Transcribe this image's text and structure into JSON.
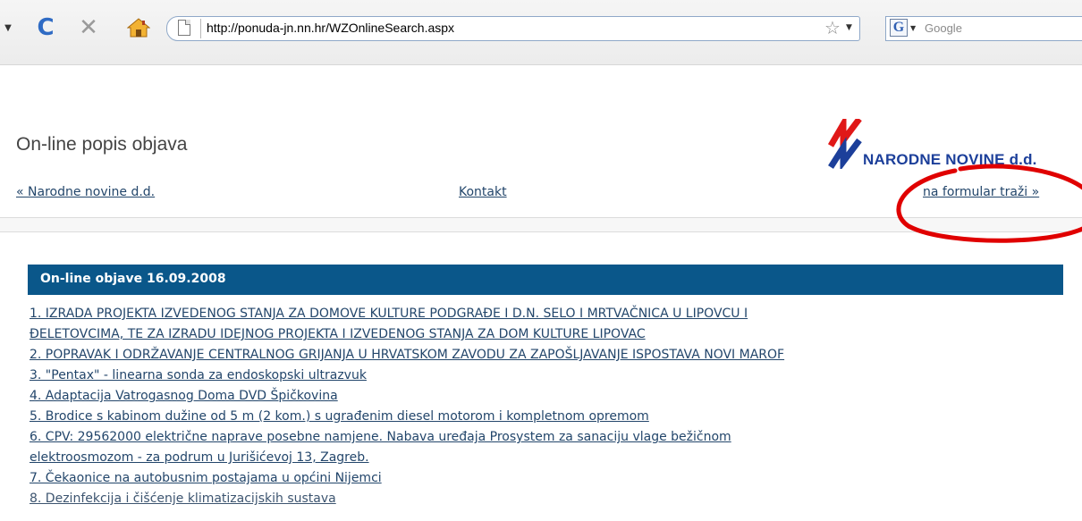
{
  "browser": {
    "url": "http://ponuda-jn.nn.hr/WZOnlineSearch.aspx",
    "search_placeholder": "Google",
    "reload_icon": "reload-icon",
    "stop_icon": "stop-icon",
    "home_icon": "home-icon",
    "search_engine_letter": "G"
  },
  "page": {
    "title": "On-line popis objava",
    "logo_text": "NARODNE NOVINE d.d.",
    "nav": {
      "back_link": "« Narodne novine d.d.",
      "contact_link": "Kontakt",
      "search_form_link": "na formular traži »"
    },
    "section_title": "On-line objave 16.09.2008",
    "items": [
      "1. IZRADA PROJEKTA IZVEDENOG STANJA ZA DOMOVE KULTURE PODGRAĐE I D.N. SELO I MRTVAČNICA U LIPOVCU I",
      "ĐELETOVCIMA, TE ZA IZRADU IDEJNOG PROJEKTA I IZVEDENOG STANJA ZA DOM KULTURE LIPOVAC",
      "2. POPRAVAK I ODRŽAVANJE CENTRALNOG GRIJANJA U HRVATSKOM ZAVODU ZA ZAPOŠLJAVANJE ISPOSTAVA NOVI MAROF",
      "3. \"Pentax\" - linearna sonda za endoskopski ultrazvuk",
      "4. Adaptacija Vatrogasnog Doma DVD Špičkovina",
      "5. Brodice s kabinom dužine od 5 m (2 kom.) s ugrađenim diesel motorom i kompletnom opremom",
      "6. CPV: 29562000 električne naprave posebne namjene. Nabava uređaja Prosystem za sanaciju vlage bežičnom",
      "elektroosmozom - za podrum u Jurišićevoj 13, Zagreb.",
      "7. Čekaonice na autobusnim postajama u općini Nijemci",
      "8. Dezinfekcija i čišćenje klimatizacijskih sustava"
    ]
  },
  "colors": {
    "section_bar": "#0a578a",
    "link": "#23466b",
    "annotation_circle": "#e00000",
    "logo_red": "#e01818",
    "logo_blue": "#1c3f9a"
  }
}
